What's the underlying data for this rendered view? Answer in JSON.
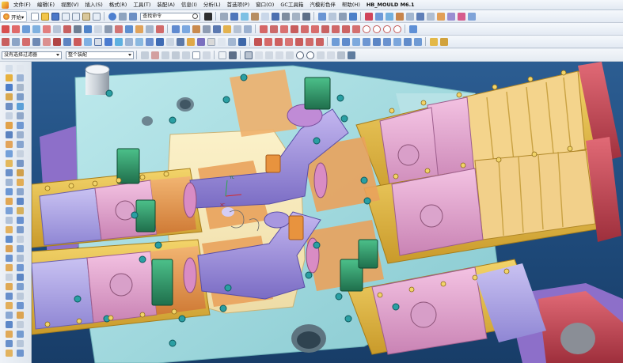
{
  "menubar": {
    "items": [
      "文件(F)",
      "编辑(E)",
      "视图(V)",
      "插入(S)",
      "格式(R)",
      "工具(T)",
      "装配(A)",
      "信息(I)",
      "分析(L)",
      "首选项(P)",
      "窗口(O)",
      "GC工具箱",
      "汽模彩色伴",
      "帮助(H)"
    ],
    "brand": "HB_MOULD M6.1"
  },
  "toolbar": {
    "start_label": "开始▾",
    "command_search_placeholder": "查找命令"
  },
  "selection_bar": {
    "filter": "没有选择过滤器",
    "scope": "整个装配"
  },
  "viewport": {
    "label_xc": "XC",
    "label_yc": "YC"
  },
  "colors": {
    "background_top": "#2c5d92",
    "background_bottom": "#183d68",
    "mould_plate_cyan": "#9fd9de",
    "cavity_cream": "#f3e6b7",
    "slider_gold": "#e3b840",
    "insert_pink": "#e6a7d1",
    "insert_orange": "#e6964e",
    "clamp_green": "#2f9a67",
    "runner_purple": "#9d8bd8",
    "frame_red": "#c94452"
  }
}
